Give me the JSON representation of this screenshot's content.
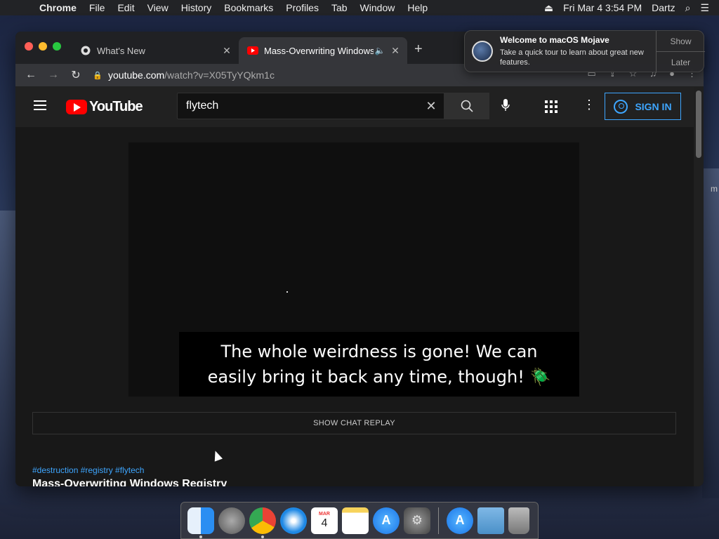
{
  "menubar": {
    "app": "Chrome",
    "items": [
      "File",
      "Edit",
      "View",
      "History",
      "Bookmarks",
      "Profiles",
      "Tab",
      "Window",
      "Help"
    ],
    "datetime": "Fri Mar 4  3:54 PM",
    "user": "Dartz"
  },
  "desktop": {
    "partial_text": "m"
  },
  "browser": {
    "tabs": [
      {
        "label": "What's New"
      },
      {
        "label": "Mass-Overwriting Windows"
      }
    ],
    "url": {
      "host": "youtube.com",
      "path": "/watch?v=X05TyYQkm1c"
    }
  },
  "youtube": {
    "logo": "YouTube",
    "search_value": "flytech",
    "signin": "SIGN IN",
    "caption_line1": "The whole weirdness is gone! We can",
    "caption_line2": "easily bring it back any time, though! 🪲",
    "chat_replay": "SHOW CHAT REPLAY",
    "hashtags": "#destruction #registry #flytech",
    "title": "Mass-Overwriting Windows Registry"
  },
  "notification": {
    "title": "Welcome to macOS Mojave",
    "body": "Take a quick tour to learn about great new features.",
    "show": "Show",
    "later": "Later"
  },
  "dock": {
    "calendar_month": "MAR",
    "calendar_day": "4"
  },
  "colors": {
    "yt_red": "#ff0000",
    "link_blue": "#3ea6ff"
  }
}
